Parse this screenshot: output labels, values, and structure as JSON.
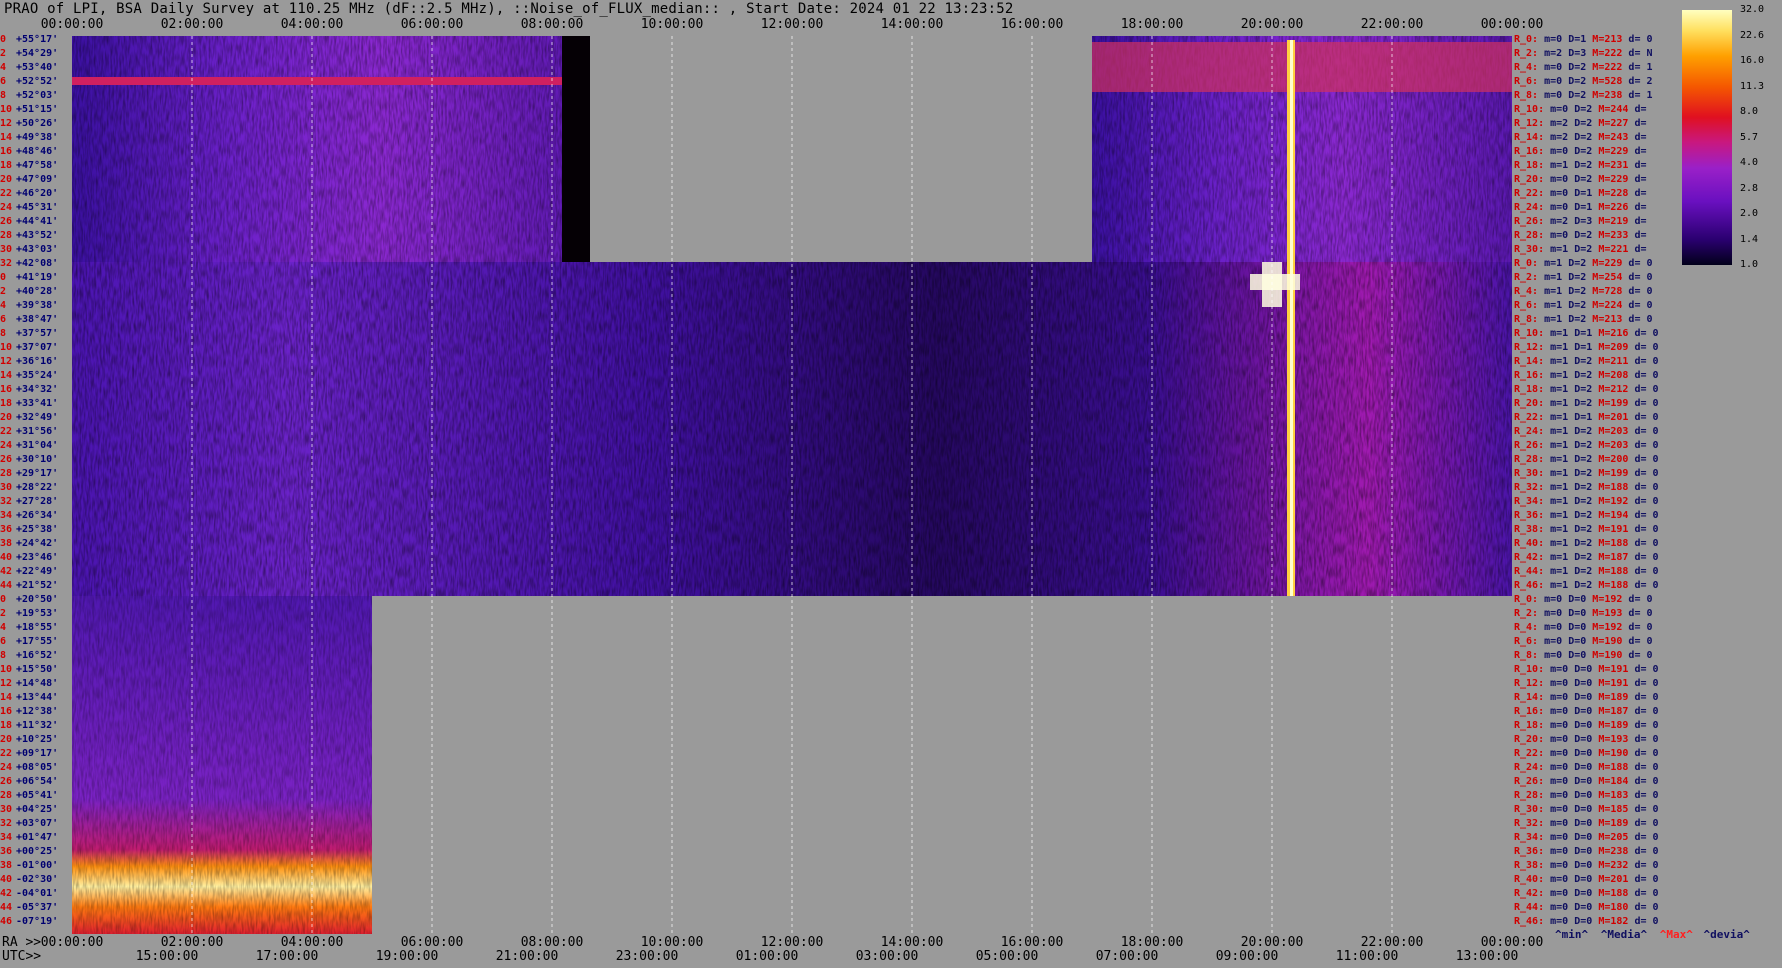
{
  "title": "PRAO of LPI, BSA Daily Survey at 110.25 MHz (dF::2.5 MHz), ::Noise_of_FLUX_median:: , Start Date: 2024 01 22 13:23:52",
  "chart_data": {
    "type": "heatmap",
    "top_axis_times": [
      "00:00:00",
      "02:00:00",
      "04:00:00",
      "06:00:00",
      "08:00:00",
      "10:00:00",
      "12:00:00",
      "14:00:00",
      "16:00:00",
      "18:00:00",
      "20:00:00",
      "22:00:00",
      "00:00:00"
    ],
    "ra_axis_prefix": "RA >>",
    "ra_axis_times": [
      "00:00:00",
      "02:00:00",
      "04:00:00",
      "06:00:00",
      "08:00:00",
      "10:00:00",
      "12:00:00",
      "14:00:00",
      "16:00:00",
      "18:00:00",
      "20:00:00",
      "22:00:00",
      "00:00:00"
    ],
    "utc_axis_prefix": "UTC>>",
    "utc_axis_times": [
      "15:00:00",
      "17:00:00",
      "19:00:00",
      "21:00:00",
      "23:00:00",
      "01:00:00",
      "03:00:00",
      "05:00:00",
      "07:00:00",
      "09:00:00",
      "11:00:00",
      "13:00:00"
    ],
    "colorbar_ticks": [
      "32.0",
      "22.6",
      "16.0",
      "11.3",
      "8.0",
      "5.7",
      "4.0",
      "2.8",
      "2.0",
      "1.4",
      "1.0"
    ],
    "row_labels": [
      [
        "0",
        "+55°17'"
      ],
      [
        "2",
        "+54°29'"
      ],
      [
        "4",
        "+53°40'"
      ],
      [
        "6",
        "+52°52'"
      ],
      [
        "8",
        "+52°03'"
      ],
      [
        "10",
        "+51°15'"
      ],
      [
        "12",
        "+50°26'"
      ],
      [
        "14",
        "+49°38'"
      ],
      [
        "16",
        "+48°46'"
      ],
      [
        "18",
        "+47°58'"
      ],
      [
        "20",
        "+47°09'"
      ],
      [
        "22",
        "+46°20'"
      ],
      [
        "24",
        "+45°31'"
      ],
      [
        "26",
        "+44°41'"
      ],
      [
        "28",
        "+43°52'"
      ],
      [
        "30",
        "+43°03'"
      ],
      [
        "32",
        "+42°08'"
      ],
      [
        "0",
        "+41°19'"
      ],
      [
        "2",
        "+40°28'"
      ],
      [
        "4",
        "+39°38'"
      ],
      [
        "6",
        "+38°47'"
      ],
      [
        "8",
        "+37°57'"
      ],
      [
        "10",
        "+37°07'"
      ],
      [
        "12",
        "+36°16'"
      ],
      [
        "14",
        "+35°24'"
      ],
      [
        "16",
        "+34°32'"
      ],
      [
        "18",
        "+33°41'"
      ],
      [
        "20",
        "+32°49'"
      ],
      [
        "22",
        "+31°56'"
      ],
      [
        "24",
        "+31°04'"
      ],
      [
        "26",
        "+30°10'"
      ],
      [
        "28",
        "+29°17'"
      ],
      [
        "30",
        "+28°22'"
      ],
      [
        "32",
        "+27°28'"
      ],
      [
        "34",
        "+26°34'"
      ],
      [
        "36",
        "+25°38'"
      ],
      [
        "38",
        "+24°42'"
      ],
      [
        "40",
        "+23°46'"
      ],
      [
        "42",
        "+22°49'"
      ],
      [
        "44",
        "+21°52'"
      ],
      [
        "0",
        "+20°50'"
      ],
      [
        "2",
        "+19°53'"
      ],
      [
        "4",
        "+18°55'"
      ],
      [
        "6",
        "+17°55'"
      ],
      [
        "8",
        "+16°52'"
      ],
      [
        "10",
        "+15°50'"
      ],
      [
        "12",
        "+14°48'"
      ],
      [
        "14",
        "+13°44'"
      ],
      [
        "16",
        "+12°38'"
      ],
      [
        "18",
        "+11°32'"
      ],
      [
        "20",
        "+10°25'"
      ],
      [
        "22",
        "+09°17'"
      ],
      [
        "24",
        "+08°05'"
      ],
      [
        "26",
        "+06°54'"
      ],
      [
        "28",
        "+05°41'"
      ],
      [
        "30",
        "+04°25'"
      ],
      [
        "32",
        "+03°07'"
      ],
      [
        "34",
        "+01°47'"
      ],
      [
        "36",
        "+00°25'"
      ],
      [
        "38",
        "-01°00'"
      ],
      [
        "40",
        "-02°30'"
      ],
      [
        "42",
        "-04°01'"
      ],
      [
        "44",
        "-05°37'"
      ],
      [
        "46",
        "-07°19'"
      ]
    ],
    "row_stats": [
      [
        "R_0:",
        "m=0",
        "D=1",
        "M=213",
        "d= 0"
      ],
      [
        "R_2:",
        "m=2",
        "D=3",
        "M=222",
        "d= N"
      ],
      [
        "R_4:",
        "m=0",
        "D=2",
        "M=222",
        "d= 1"
      ],
      [
        "R_6:",
        "m=0",
        "D=2",
        "M=528",
        "d= 2"
      ],
      [
        "R_8:",
        "m=0",
        "D=2",
        "M=238",
        "d= 1"
      ],
      [
        "R_10:",
        "m=0",
        "D=2",
        "M=244",
        "d="
      ],
      [
        "R_12:",
        "m=2",
        "D=2",
        "M=227",
        "d="
      ],
      [
        "R_14:",
        "m=2",
        "D=2",
        "M=243",
        "d="
      ],
      [
        "R_16:",
        "m=0",
        "D=2",
        "M=229",
        "d="
      ],
      [
        "R_18:",
        "m=1",
        "D=2",
        "M=231",
        "d="
      ],
      [
        "R_20:",
        "m=0",
        "D=2",
        "M=229",
        "d="
      ],
      [
        "R_22:",
        "m=0",
        "D=1",
        "M=228",
        "d="
      ],
      [
        "R_24:",
        "m=0",
        "D=1",
        "M=226",
        "d="
      ],
      [
        "R_26:",
        "m=2",
        "D=3",
        "M=219",
        "d="
      ],
      [
        "R_28:",
        "m=0",
        "D=2",
        "M=233",
        "d="
      ],
      [
        "R_30:",
        "m=1",
        "D=2",
        "M=221",
        "d="
      ],
      [
        "R_0:",
        "m=1",
        "D=2",
        "M=229",
        "d= 0"
      ],
      [
        "R_2:",
        "m=1",
        "D=2",
        "M=254",
        "d= 0"
      ],
      [
        "R_4:",
        "m=1",
        "D=2",
        "M=728",
        "d= 0"
      ],
      [
        "R_6:",
        "m=1",
        "D=2",
        "M=224",
        "d= 0"
      ],
      [
        "R_8:",
        "m=1",
        "D=2",
        "M=213",
        "d= 0"
      ],
      [
        "R_10:",
        "m=1",
        "D=1",
        "M=216",
        "d= 0"
      ],
      [
        "R_12:",
        "m=1",
        "D=1",
        "M=209",
        "d= 0"
      ],
      [
        "R_14:",
        "m=1",
        "D=2",
        "M=211",
        "d= 0"
      ],
      [
        "R_16:",
        "m=1",
        "D=2",
        "M=208",
        "d= 0"
      ],
      [
        "R_18:",
        "m=1",
        "D=2",
        "M=212",
        "d= 0"
      ],
      [
        "R_20:",
        "m=1",
        "D=2",
        "M=199",
        "d= 0"
      ],
      [
        "R_22:",
        "m=1",
        "D=1",
        "M=201",
        "d= 0"
      ],
      [
        "R_24:",
        "m=1",
        "D=2",
        "M=203",
        "d= 0"
      ],
      [
        "R_26:",
        "m=1",
        "D=2",
        "M=203",
        "d= 0"
      ],
      [
        "R_28:",
        "m=1",
        "D=2",
        "M=200",
        "d= 0"
      ],
      [
        "R_30:",
        "m=1",
        "D=2",
        "M=199",
        "d= 0"
      ],
      [
        "R_32:",
        "m=1",
        "D=2",
        "M=188",
        "d= 0"
      ],
      [
        "R_34:",
        "m=1",
        "D=2",
        "M=192",
        "d= 0"
      ],
      [
        "R_36:",
        "m=1",
        "D=2",
        "M=194",
        "d= 0"
      ],
      [
        "R_38:",
        "m=1",
        "D=2",
        "M=191",
        "d= 0"
      ],
      [
        "R_40:",
        "m=1",
        "D=2",
        "M=188",
        "d= 0"
      ],
      [
        "R_42:",
        "m=1",
        "D=2",
        "M=187",
        "d= 0"
      ],
      [
        "R_44:",
        "m=1",
        "D=2",
        "M=188",
        "d= 0"
      ],
      [
        "R_46:",
        "m=1",
        "D=2",
        "M=188",
        "d= 0"
      ],
      [
        "R_0:",
        "m=0",
        "D=0",
        "M=192",
        "d= 0"
      ],
      [
        "R_2:",
        "m=0",
        "D=0",
        "M=193",
        "d= 0"
      ],
      [
        "R_4:",
        "m=0",
        "D=0",
        "M=192",
        "d= 0"
      ],
      [
        "R_6:",
        "m=0",
        "D=0",
        "M=190",
        "d= 0"
      ],
      [
        "R_8:",
        "m=0",
        "D=0",
        "M=190",
        "d= 0"
      ],
      [
        "R_10:",
        "m=0",
        "D=0",
        "M=191",
        "d= 0"
      ],
      [
        "R_12:",
        "m=0",
        "D=0",
        "M=191",
        "d= 0"
      ],
      [
        "R_14:",
        "m=0",
        "D=0",
        "M=189",
        "d= 0"
      ],
      [
        "R_16:",
        "m=0",
        "D=0",
        "M=187",
        "d= 0"
      ],
      [
        "R_18:",
        "m=0",
        "D=0",
        "M=189",
        "d= 0"
      ],
      [
        "R_20:",
        "m=0",
        "D=0",
        "M=193",
        "d= 0"
      ],
      [
        "R_22:",
        "m=0",
        "D=0",
        "M=190",
        "d= 0"
      ],
      [
        "R_24:",
        "m=0",
        "D=0",
        "M=188",
        "d= 0"
      ],
      [
        "R_26:",
        "m=0",
        "D=0",
        "M=184",
        "d= 0"
      ],
      [
        "R_28:",
        "m=0",
        "D=0",
        "M=183",
        "d= 0"
      ],
      [
        "R_30:",
        "m=0",
        "D=0",
        "M=185",
        "d= 0"
      ],
      [
        "R_32:",
        "m=0",
        "D=0",
        "M=189",
        "d= 0"
      ],
      [
        "R_34:",
        "m=0",
        "D=0",
        "M=205",
        "d= 0"
      ],
      [
        "R_36:",
        "m=0",
        "D=0",
        "M=238",
        "d= 0"
      ],
      [
        "R_38:",
        "m=0",
        "D=0",
        "M=232",
        "d= 0"
      ],
      [
        "R_40:",
        "m=0",
        "D=0",
        "M=201",
        "d= 0"
      ],
      [
        "R_42:",
        "m=0",
        "D=0",
        "M=188",
        "d= 0"
      ],
      [
        "R_44:",
        "m=0",
        "D=0",
        "M=180",
        "d= 0"
      ],
      [
        "R_46:",
        "m=0",
        "D=0",
        "M=182",
        "d= 0"
      ]
    ],
    "legend": [
      "^min^",
      "^Media^",
      "^Max^",
      "^devia^"
    ],
    "colors": {
      "background": "#9a9a9a",
      "row_index": "#d00000",
      "declination": "#000070",
      "legend_max": "#ff2020",
      "legend_other": "#101060"
    }
  }
}
